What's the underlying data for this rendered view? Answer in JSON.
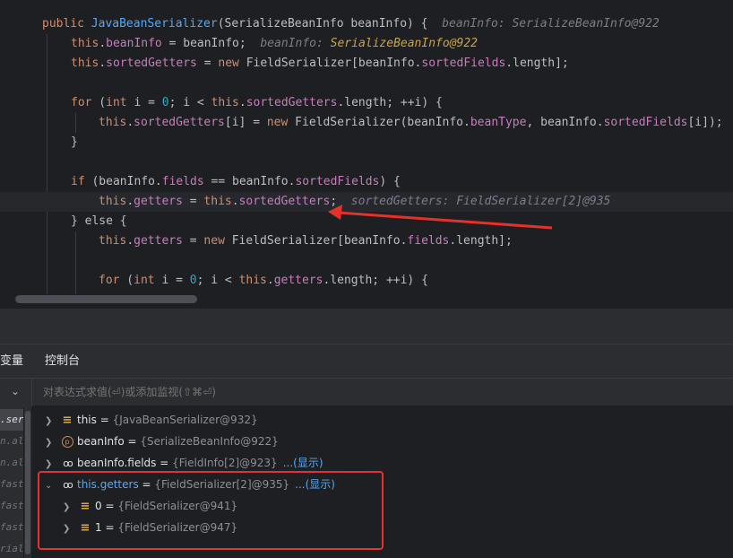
{
  "editor": {
    "lines": [
      {
        "key": "l1"
      },
      {
        "key": "l2"
      }
    ],
    "tokens": {
      "public": "public",
      "class_name": "JavaBeanSerializer",
      "param_type": "SerializeBeanInfo",
      "param": "beanInfo",
      "paren_open": "(",
      "paren_close_brace": ") {",
      "hint1": "beanInfo: SerializeBeanInfo@922",
      "this": "this",
      "dot": ".",
      "beanInfo_field": "beanInfo",
      "assign": " = ",
      "beanInfo_semicolon": "beanInfo;",
      "hint2_name": "beanInfo: ",
      "hint2_type": "SerializeBeanInfo@922",
      "sortedGetters": "sortedGetters",
      "new": "new",
      "FieldSerializer": "FieldSerializer",
      "arr3": "[beanInfo.",
      "sortedFields": "sortedFields",
      "length_close": ".length];",
      "for": "for",
      "int": "int",
      "i_assign": " i = ",
      "zero": "0",
      "i_lt": "; i < ",
      "length_inc": ".length; ++i) {",
      "sg_i": "[i] = ",
      "fs_open": "FieldSerializer(beanInfo.",
      "beanType": "beanType",
      "comma_beanInfo": ", beanInfo.",
      "sorted_end": "[i]);",
      "close_brace": "}",
      "if": "if",
      "if_open": " (beanInfo.",
      "fields": "fields",
      "eq_beanInfo": " == beanInfo.",
      "if_close": ") {",
      "getters": "getters",
      "this_sg_semicolon": ";",
      "hint3": "sortedGetters: FieldSerializer[2]@935",
      "else": "} else {",
      "arr_fields": "[beanInfo.",
      "for2_tail": ".length; ++i) {"
    }
  },
  "debugger": {
    "tab_variables": "变量",
    "tab_console": "控制台",
    "eval_placeholder": "对表达式求值(⏎)或添加监视(⇧⌘⏎)",
    "frames": [
      ".ser",
      "n.ali",
      "n.ali",
      "fast",
      "fast",
      "fast",
      "riali"
    ],
    "variables": [
      {
        "name": "this",
        "eq": " = ",
        "value": "{JavaBeanSerializer@932}",
        "icon": "field-lines-icon",
        "more": ""
      },
      {
        "name": "beanInfo",
        "eq": " = ",
        "value": "{SerializeBeanInfo@922}",
        "icon": "parameter-icon",
        "more": ""
      },
      {
        "name": "beanInfo.fields",
        "eq": " = ",
        "value": "{FieldInfo[2]@923}",
        "icon": "watch-glasses-icon",
        "more": "...(显示)"
      },
      {
        "name": "this.getters",
        "eq": " = ",
        "value": "{FieldSerializer[2]@935}",
        "icon": "watch-glasses-icon",
        "more": "...(显示)"
      },
      {
        "name": "0",
        "eq": " = ",
        "value": "{FieldSerializer@941}",
        "icon": "field-lines-icon",
        "more": ""
      },
      {
        "name": "1",
        "eq": " = ",
        "value": "{FieldSerializer@947}",
        "icon": "field-lines-icon",
        "more": ""
      }
    ]
  },
  "colors": {
    "annotation_red": "#e5302c",
    "link_blue": "#56a8f5"
  }
}
